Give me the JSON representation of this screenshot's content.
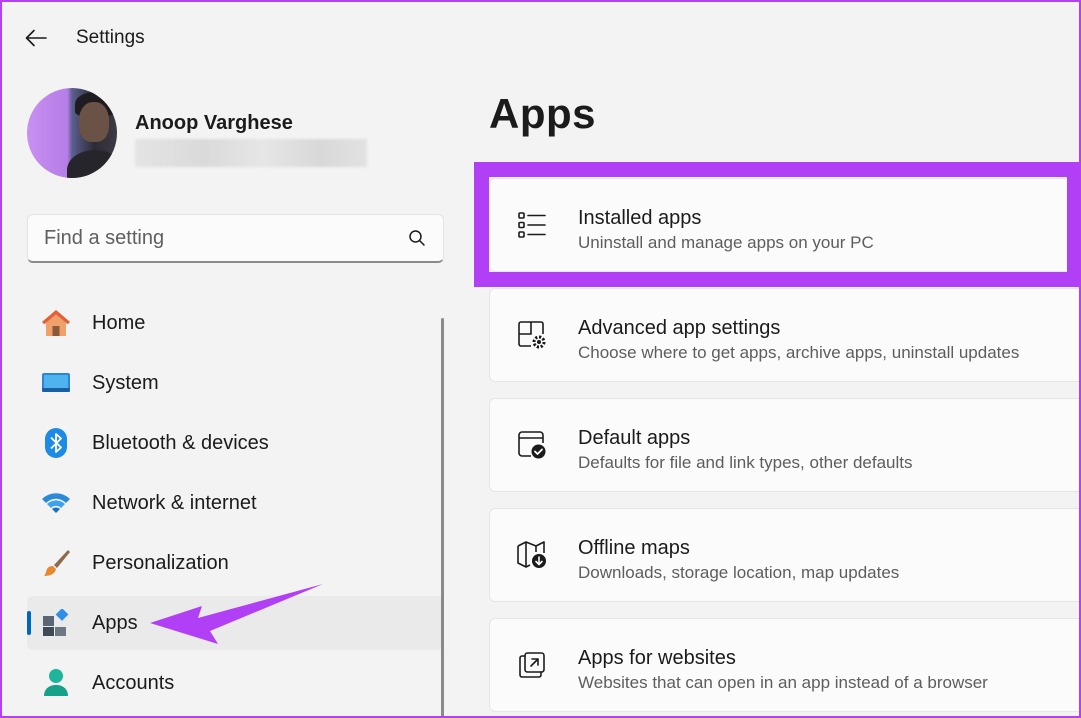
{
  "window": {
    "title": "Settings"
  },
  "profile": {
    "name": "Anoop Varghese"
  },
  "search": {
    "placeholder": "Find a setting"
  },
  "nav": {
    "items": [
      {
        "label": "Home",
        "icon": "home-icon"
      },
      {
        "label": "System",
        "icon": "system-icon"
      },
      {
        "label": "Bluetooth & devices",
        "icon": "bluetooth-icon"
      },
      {
        "label": "Network & internet",
        "icon": "wifi-icon"
      },
      {
        "label": "Personalization",
        "icon": "brush-icon"
      },
      {
        "label": "Apps",
        "icon": "apps-icon",
        "active": true
      },
      {
        "label": "Accounts",
        "icon": "account-icon"
      }
    ]
  },
  "main": {
    "title": "Apps",
    "cards": [
      {
        "title": "Installed apps",
        "description": "Uninstall and manage apps on your PC",
        "icon": "list-icon",
        "highlighted": true
      },
      {
        "title": "Advanced app settings",
        "description": "Choose where to get apps, archive apps, uninstall updates",
        "icon": "app-settings-icon"
      },
      {
        "title": "Default apps",
        "description": "Defaults for file and link types, other defaults",
        "icon": "default-apps-icon"
      },
      {
        "title": "Offline maps",
        "description": "Downloads, storage location, map updates",
        "icon": "map-download-icon"
      },
      {
        "title": "Apps for websites",
        "description": "Websites that can open in an app instead of a browser",
        "icon": "open-external-icon"
      }
    ]
  },
  "colors": {
    "accent": "#0067c0",
    "highlight": "#b13ff5",
    "background": "#f3f3f3",
    "card": "#fbfbfb"
  }
}
